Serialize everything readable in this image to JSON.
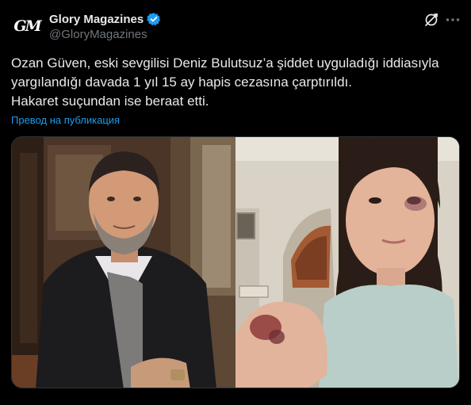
{
  "account": {
    "display_name": "Glory Magazines",
    "handle": "@GloryMagazines",
    "avatar_text": "GM"
  },
  "tweet": {
    "lines": [
      "Ozan Güven, eski sevgilisi Deniz Bulutsuz’a şiddet uyguladığı iddiasıyla",
      "yargılandığı davada 1 yıl 15 ay hapis cezasına çarptırıldı.",
      "Hakaret suçundan ise beraat etti."
    ],
    "translate_label": "Превод на публикация"
  },
  "icons": {
    "verified": "verified-badge-icon",
    "grok": "grok-icon",
    "more": "more-icon"
  },
  "colors": {
    "background": "#000000",
    "text": "#e7e9ea",
    "secondary_text": "#71767b",
    "link": "#1d9bf0",
    "verified": "#1d9bf0"
  }
}
